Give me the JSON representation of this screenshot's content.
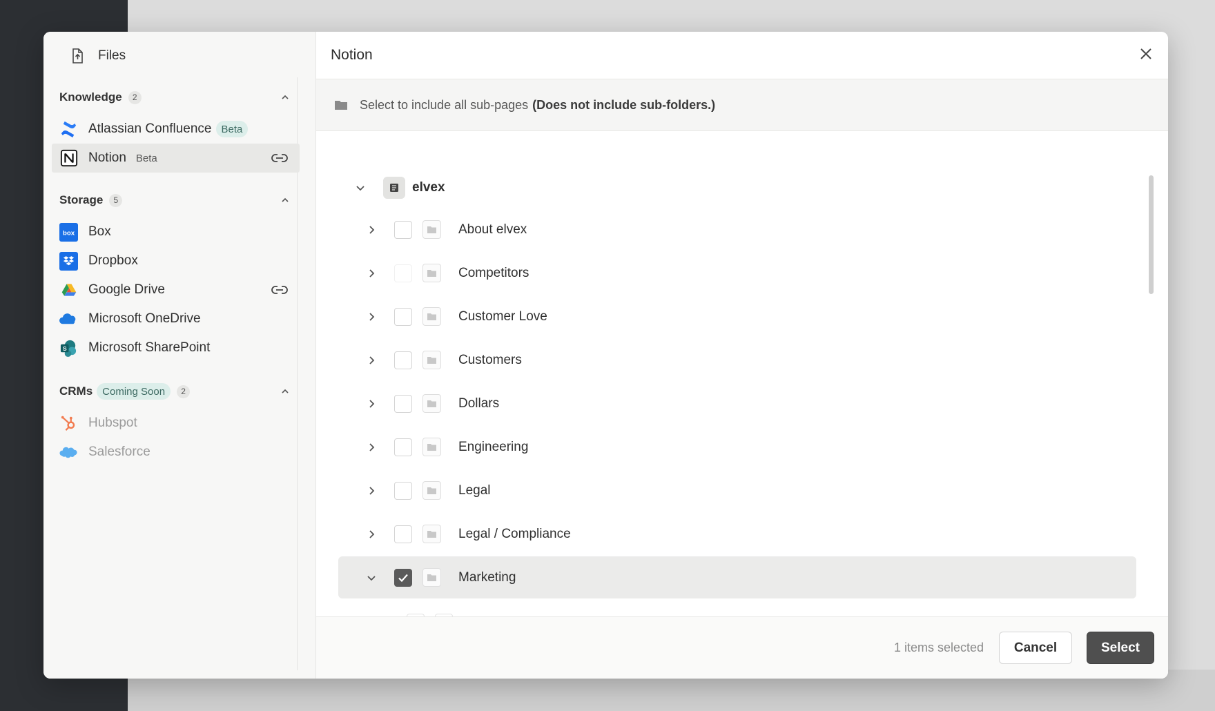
{
  "sidebar": {
    "files_label": "Files",
    "sections": [
      {
        "title": "Knowledge",
        "count": "2",
        "items": [
          {
            "label": "Atlassian Confluence",
            "badge": "Beta",
            "icon": "confluence-logo"
          },
          {
            "label": "Notion",
            "badge": "Beta",
            "icon": "notion-logo",
            "active": true,
            "linked": true
          }
        ]
      },
      {
        "title": "Storage",
        "count": "5",
        "items": [
          {
            "label": "Box",
            "icon": "box-logo"
          },
          {
            "label": "Dropbox",
            "icon": "dropbox-logo"
          },
          {
            "label": "Google Drive",
            "icon": "google-drive-logo",
            "linked": true
          },
          {
            "label": "Microsoft OneDrive",
            "icon": "onedrive-logo"
          },
          {
            "label": "Microsoft SharePoint",
            "icon": "sharepoint-logo"
          }
        ]
      },
      {
        "title": "CRMs",
        "badge": "Coming Soon",
        "count": "2",
        "items": [
          {
            "label": "Hubspot",
            "icon": "hubspot-logo",
            "disabled": true
          },
          {
            "label": "Salesforce",
            "icon": "salesforce-logo",
            "disabled": true
          }
        ]
      }
    ]
  },
  "main": {
    "title": "Notion",
    "info_text": "Select to include all sub-pages",
    "info_bold": "(Does not include sub-folders.)",
    "root": {
      "label": "elvex",
      "expanded": true
    },
    "pages": [
      {
        "label": "About elvex",
        "checked": false
      },
      {
        "label": "Competitors",
        "checked": false
      },
      {
        "label": "Customer Love",
        "checked": false
      },
      {
        "label": "Customers",
        "checked": false
      },
      {
        "label": "Dollars",
        "checked": false
      },
      {
        "label": "Engineering",
        "checked": false
      },
      {
        "label": "Legal",
        "checked": false
      },
      {
        "label": "Legal / Compliance",
        "checked": false
      },
      {
        "label": "Marketing",
        "checked": true,
        "expanded": true
      }
    ]
  },
  "footer": {
    "status": "1 items selected",
    "cancel_label": "Cancel",
    "select_label": "Select"
  },
  "colors": {
    "accent_dark": "#4f4f4f",
    "badge_bg": "#dceeea",
    "badge_text": "#3d6a62",
    "active_row": "#e8e8e6"
  }
}
